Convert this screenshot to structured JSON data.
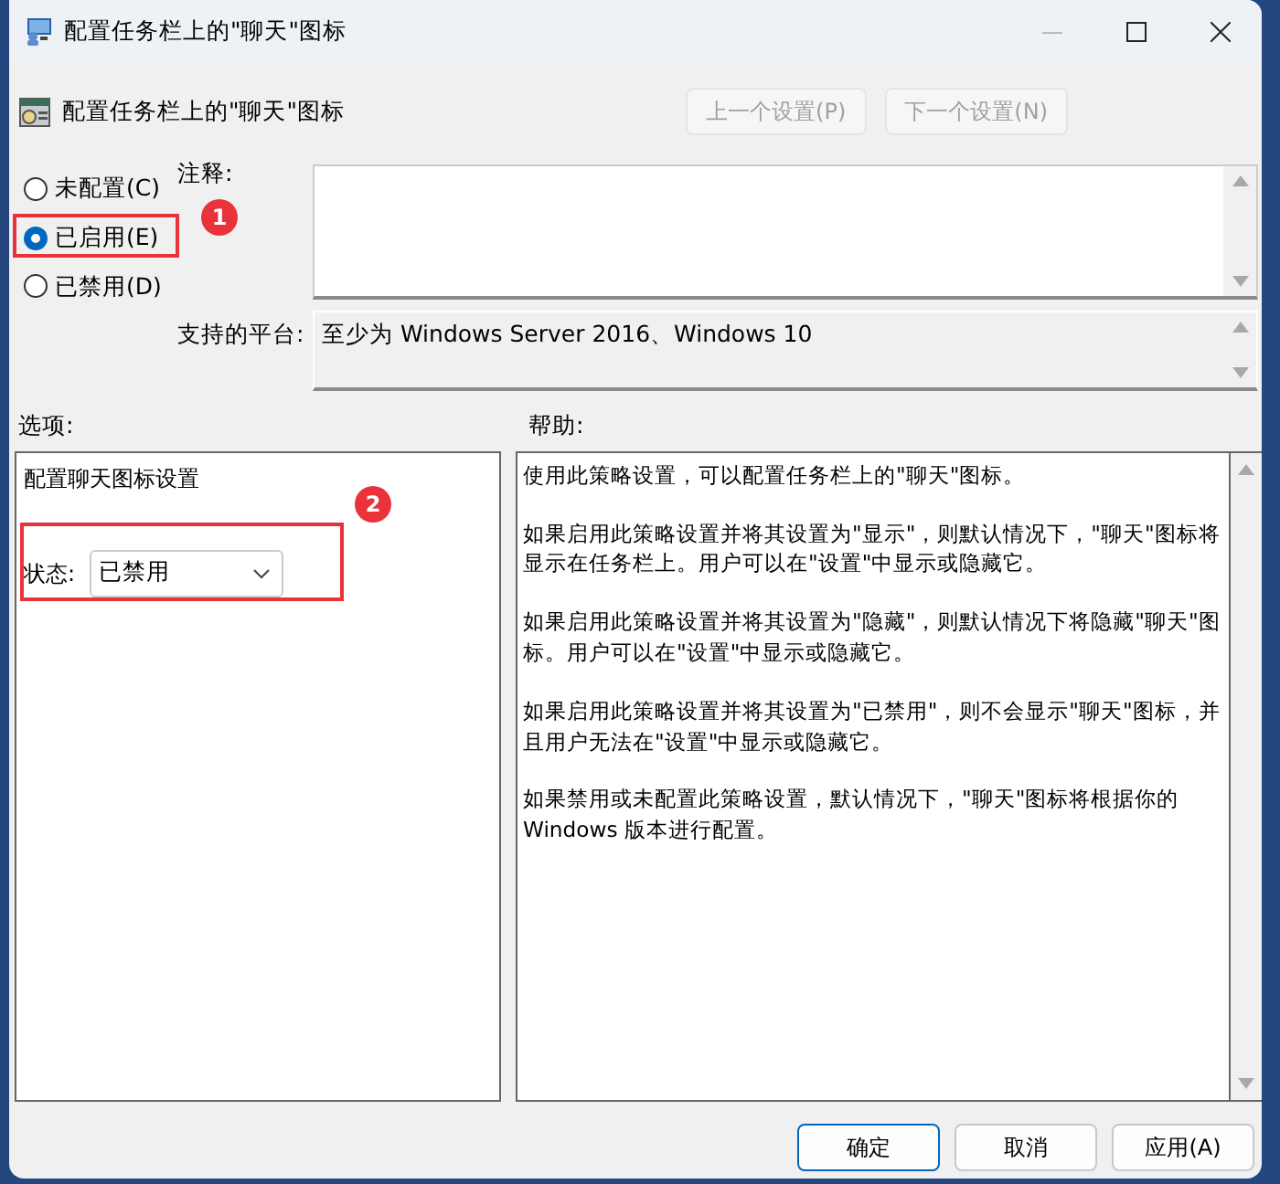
{
  "window": {
    "title": "配置任务栏上的\"聊天\"图标"
  },
  "header": {
    "title": "配置任务栏上的\"聊天\"图标",
    "buttons": [
      {
        "label": "上一个设置(P)",
        "disabled": true
      },
      {
        "label": "下一个设置(N)",
        "disabled": true
      }
    ]
  },
  "radios": [
    {
      "label": "未配置(C)",
      "selected": false,
      "highlighted": false
    },
    {
      "label": "已启用(E)",
      "selected": true,
      "highlighted": true,
      "badge": "1"
    },
    {
      "label": "已禁用(D)",
      "selected": false,
      "highlighted": false
    }
  ],
  "comment": {
    "label": "注释:"
  },
  "platform": {
    "label": "支持的平台:",
    "value": "至少为 Windows Server 2016、Windows 10"
  },
  "options": {
    "label": "选项:",
    "heading": "配置聊天图标设置",
    "state_label": "状态:",
    "state_value": "已禁用",
    "highlighted": true,
    "badge": "2"
  },
  "help": {
    "label": "帮助:",
    "paragraphs": [
      "使用此策略设置，可以配置任务栏上的\"聊天\"图标。",
      "如果启用此策略设置并将其设置为\"显示\"，则默认情况下，\"聊天\"图标将显示在任务栏上。用户可以在\"设置\"中显示或隐藏它。",
      "如果启用此策略设置并将其设置为\"隐藏\"，则默认情况下将隐藏\"聊天\"图标。用户可以在\"设置\"中显示或隐藏它。",
      "如果启用此策略设置并将其设置为\"已禁用\"，则不会显示\"聊天\"图标，并且用户无法在\"设置\"中显示或隐藏它。",
      "如果禁用或未配置此策略设置，默认情况下，\"聊天\"图标将根据你的 Windows 版本进行配置。"
    ]
  },
  "buttons": [
    {
      "label": "确定",
      "default": true
    },
    {
      "label": "取消",
      "default": false
    },
    {
      "label": "应用(A)",
      "default": false
    }
  ]
}
